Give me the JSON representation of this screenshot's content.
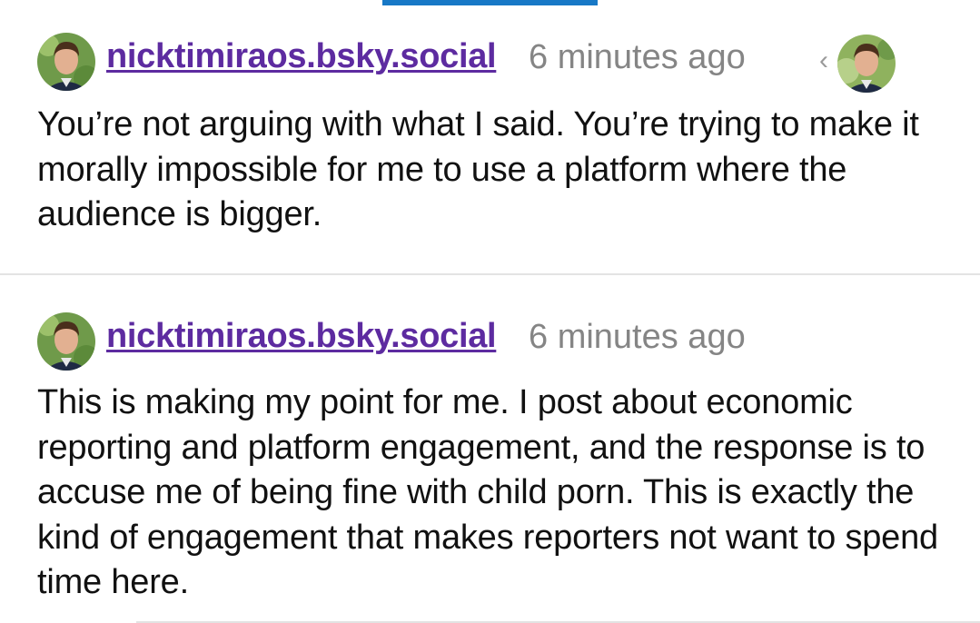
{
  "posts": [
    {
      "handle": "nicktimiraos.bsky.social",
      "timestamp": "6 minutes ago",
      "body": "You’re not arguing with what I said. You’re trying to make it morally impossible for me to use a platform where the audience is bigger."
    },
    {
      "handle": "nicktimiraos.bsky.social",
      "timestamp": "6 minutes ago",
      "body": "This is making my point for me. I post about economic reporting and platform engagement, and the response is to accuse me of being fine with child porn. This is exactly the kind of engagement that makes reporters not want to spend time here."
    }
  ],
  "thread_nav": {
    "chevron": "‹"
  },
  "colors": {
    "handle": "#5d2ba0",
    "timestamp": "#858585",
    "accent": "#1778c6",
    "divider": "#e3e3e3",
    "text": "#111111"
  },
  "icons": {
    "avatar": "user-avatar-photo",
    "back": "chevron-left-icon"
  }
}
